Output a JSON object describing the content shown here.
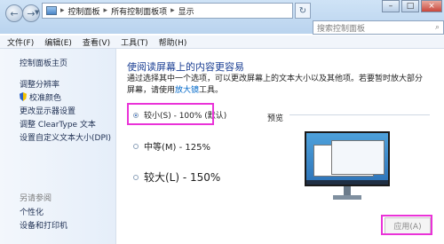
{
  "address": {
    "crumbs": [
      "控制面板",
      "所有控制面板项",
      "显示"
    ],
    "search_placeholder": "搜索控制面板"
  },
  "menu": [
    "文件(F)",
    "编辑(E)",
    "查看(V)",
    "工具(T)",
    "帮助(H)"
  ],
  "sidebar": {
    "home": "控制面板主页",
    "items": [
      "调整分辨率",
      "校准颜色",
      "更改显示器设置",
      "调整 ClearType 文本",
      "设置自定义文本大小(DPI)"
    ],
    "see_also_title": "另请参阅",
    "see_also": [
      "个性化",
      "设备和打印机"
    ]
  },
  "main": {
    "heading": "使阅读屏幕上的内容更容易",
    "description_1": "通过选择其中一个选项，可以更改屏幕上的文本大小以及其他项。若要暂时放大部分屏幕，请使用",
    "description_link": "放大镜",
    "description_2": "工具。",
    "options": [
      "较小(S) - 100% (默认)",
      "中等(M) - 125%",
      "较大(L) - 150%"
    ],
    "selected_option": 0,
    "preview_label": "预览",
    "apply_label": "应用(A)"
  },
  "colors": {
    "highlight": "#ea33d8",
    "heading": "#1b3f93",
    "link": "#0068c9"
  }
}
